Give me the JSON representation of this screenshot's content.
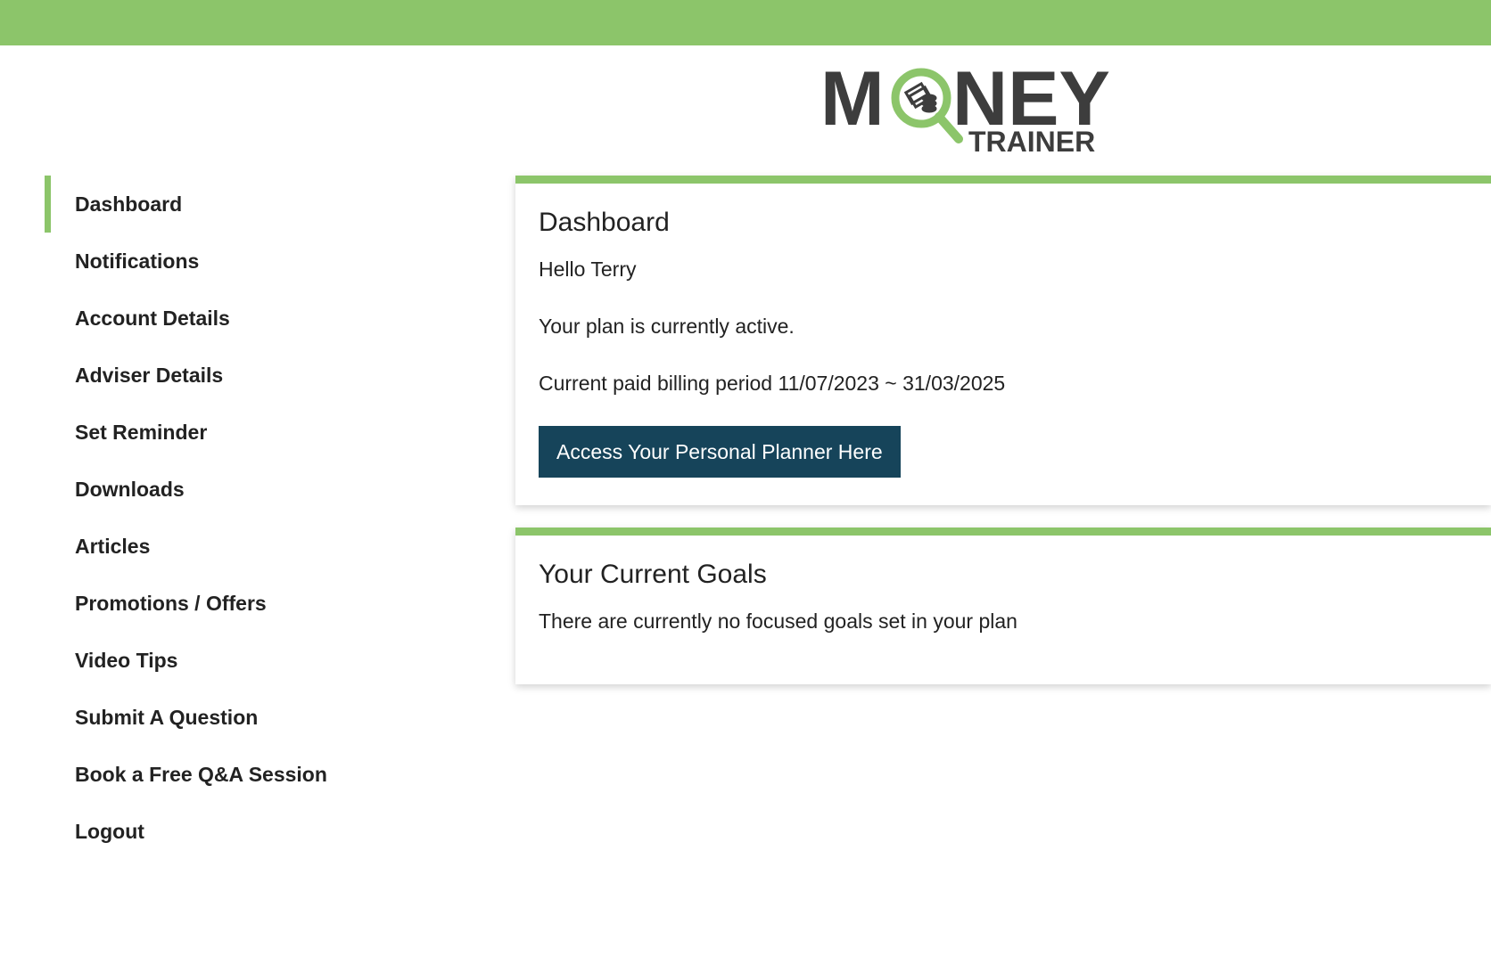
{
  "header": {
    "bar_color": "#8cc56a"
  },
  "logo": {
    "word_main": "MONEY",
    "word_sub": "TRAINER",
    "accent_color": "#8cc56a",
    "text_color": "#3d3d3d"
  },
  "sidebar": {
    "items": [
      {
        "label": "Dashboard",
        "active": true
      },
      {
        "label": "Notifications"
      },
      {
        "label": "Account Details"
      },
      {
        "label": "Adviser Details"
      },
      {
        "label": "Set Reminder"
      },
      {
        "label": "Downloads"
      },
      {
        "label": "Articles"
      },
      {
        "label": "Promotions / Offers"
      },
      {
        "label": "Video Tips"
      },
      {
        "label": "Submit A Question"
      },
      {
        "label": "Book a Free Q&A Session"
      },
      {
        "label": "Logout"
      }
    ]
  },
  "dashboard": {
    "title": "Dashboard",
    "greeting": "Hello Terry",
    "plan_status": "Your plan is currently active.",
    "billing_period": "Current paid billing period 11/07/2023 ~ 31/03/2025",
    "planner_button": "Access Your Personal Planner Here",
    "button_color": "#16445a"
  },
  "goals": {
    "title": "Your Current Goals",
    "message": "There are currently no focused goals set in your plan"
  }
}
